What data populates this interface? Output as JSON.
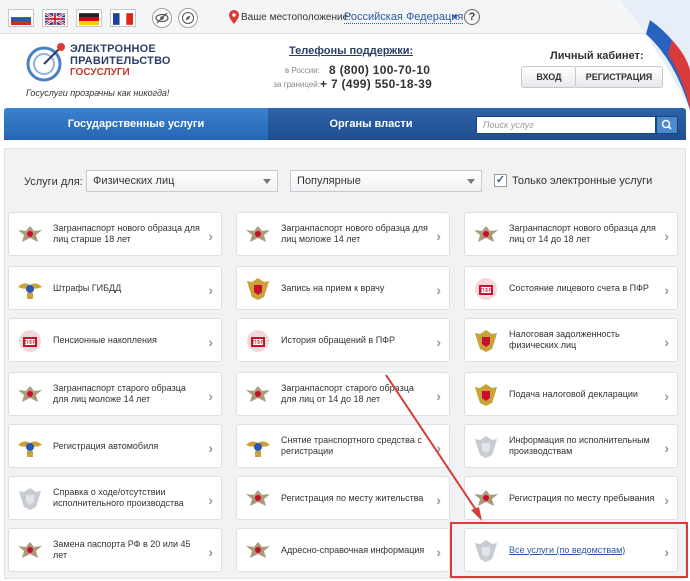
{
  "topbar": {
    "location_label": "Ваше местоположение:",
    "location_value": "Российская Федерация",
    "help_label": "?"
  },
  "logo": {
    "line1": "ЭЛЕКТРОННОЕ",
    "line2": "ПРАВИТЕЛЬСТВО",
    "line3": "ГОСУСЛУГИ",
    "slogan": "Госуслуги прозрачны как никогда!"
  },
  "support": {
    "title": "Телефоны поддержки:",
    "label_russia": "в России:",
    "phone_russia": "8 (800) 100-70-10",
    "label_abroad": "за границей:",
    "phone_abroad": "+ 7 (499) 550-18-39"
  },
  "cabinet": {
    "title": "Личный кабинет:",
    "login": "ВХОД",
    "register": "РЕГИСТРАЦИЯ"
  },
  "nav": {
    "tab_services": "Государственные услуги",
    "tab_authorities": "Органы власти",
    "search_placeholder": "Поиск услуг"
  },
  "filters": {
    "label": "Услуги для:",
    "audience": "Физических лиц",
    "sort": "Популярные",
    "only_electronic_checked": true,
    "only_electronic_label": "Только электронные услуги"
  },
  "services": [
    {
      "label": "Загранпаспорт нового образца для лиц старше 18 лет",
      "icon": "eagle-emblem-icon"
    },
    {
      "label": "Загранпаспорт нового образца для лиц моложе 14 лет",
      "icon": "eagle-emblem-icon"
    },
    {
      "label": "Загранпаспорт нового образца для лиц от 14 до 18 лет",
      "icon": "eagle-emblem-icon"
    },
    {
      "label": "Штрафы ГИБДД",
      "icon": "gibdd-emblem-icon"
    },
    {
      "label": "Запись на прием к врачу",
      "icon": "coat-of-arms-icon"
    },
    {
      "label": "Состояние лицевого счета в ПФР",
      "icon": "pfr-emblem-icon"
    },
    {
      "label": "Пенсионные накопления",
      "icon": "pfr-emblem-icon"
    },
    {
      "label": "История обращений в ПФР",
      "icon": "pfr-emblem-icon"
    },
    {
      "label": "Налоговая задолженность физических лиц",
      "icon": "coat-of-arms-icon"
    },
    {
      "label": "Загранпаспорт старого образца для лиц моложе 14 лет",
      "icon": "eagle-emblem-icon"
    },
    {
      "label": "Загранпаспорт старого образца для лиц от 14 до 18 лет",
      "icon": "eagle-emblem-icon"
    },
    {
      "label": "Подача налоговой декларации",
      "icon": "coat-of-arms-icon"
    },
    {
      "label": "Регистрация автомобиля",
      "icon": "gibdd-emblem-icon"
    },
    {
      "label": "Снятие транспортного средства с регистрации",
      "icon": "gibdd-emblem-icon"
    },
    {
      "label": "Информация по исполнительным производствам",
      "icon": "coat-of-arms-gray-icon"
    },
    {
      "label": "Справка о ходе/отсутствии исполнительного производства",
      "icon": "coat-of-arms-gray-icon"
    },
    {
      "label": "Регистрация по месту жительства",
      "icon": "eagle-emblem-icon"
    },
    {
      "label": "Регистрация по месту пребывания",
      "icon": "eagle-emblem-icon"
    },
    {
      "label": "Замена паспорта РФ в 20 или 45 лет",
      "icon": "eagle-emblem-icon"
    },
    {
      "label": "Адресно-справочная информация",
      "icon": "eagle-emblem-icon"
    },
    {
      "label": "Все услуги (по ведомствам)",
      "icon": "coat-of-arms-gray-icon"
    }
  ],
  "colors": {
    "nav_blue": "#2566b4",
    "highlight_red": "#d93a3a",
    "link_blue": "#2a5aa8"
  }
}
